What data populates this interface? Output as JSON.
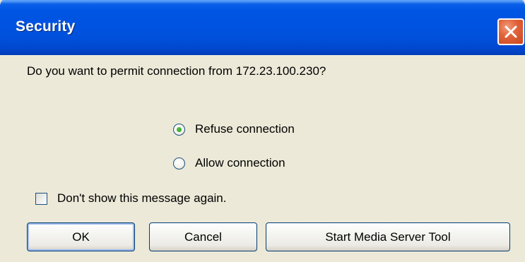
{
  "window": {
    "title": "Security",
    "close_icon": "close-icon",
    "close_color": "#E2643B",
    "titlebar_color": "#0054E3"
  },
  "dialog": {
    "question": "Do you want to permit connection from 172.23.100.230?",
    "options": [
      {
        "label": "Refuse connection",
        "checked": true
      },
      {
        "label": "Allow connection",
        "checked": false
      }
    ],
    "dont_show_again": {
      "label": "Don't show this message again.",
      "checked": false
    }
  },
  "buttons": {
    "ok": "OK",
    "cancel": "Cancel",
    "media_tool": "Start Media Server Tool"
  }
}
